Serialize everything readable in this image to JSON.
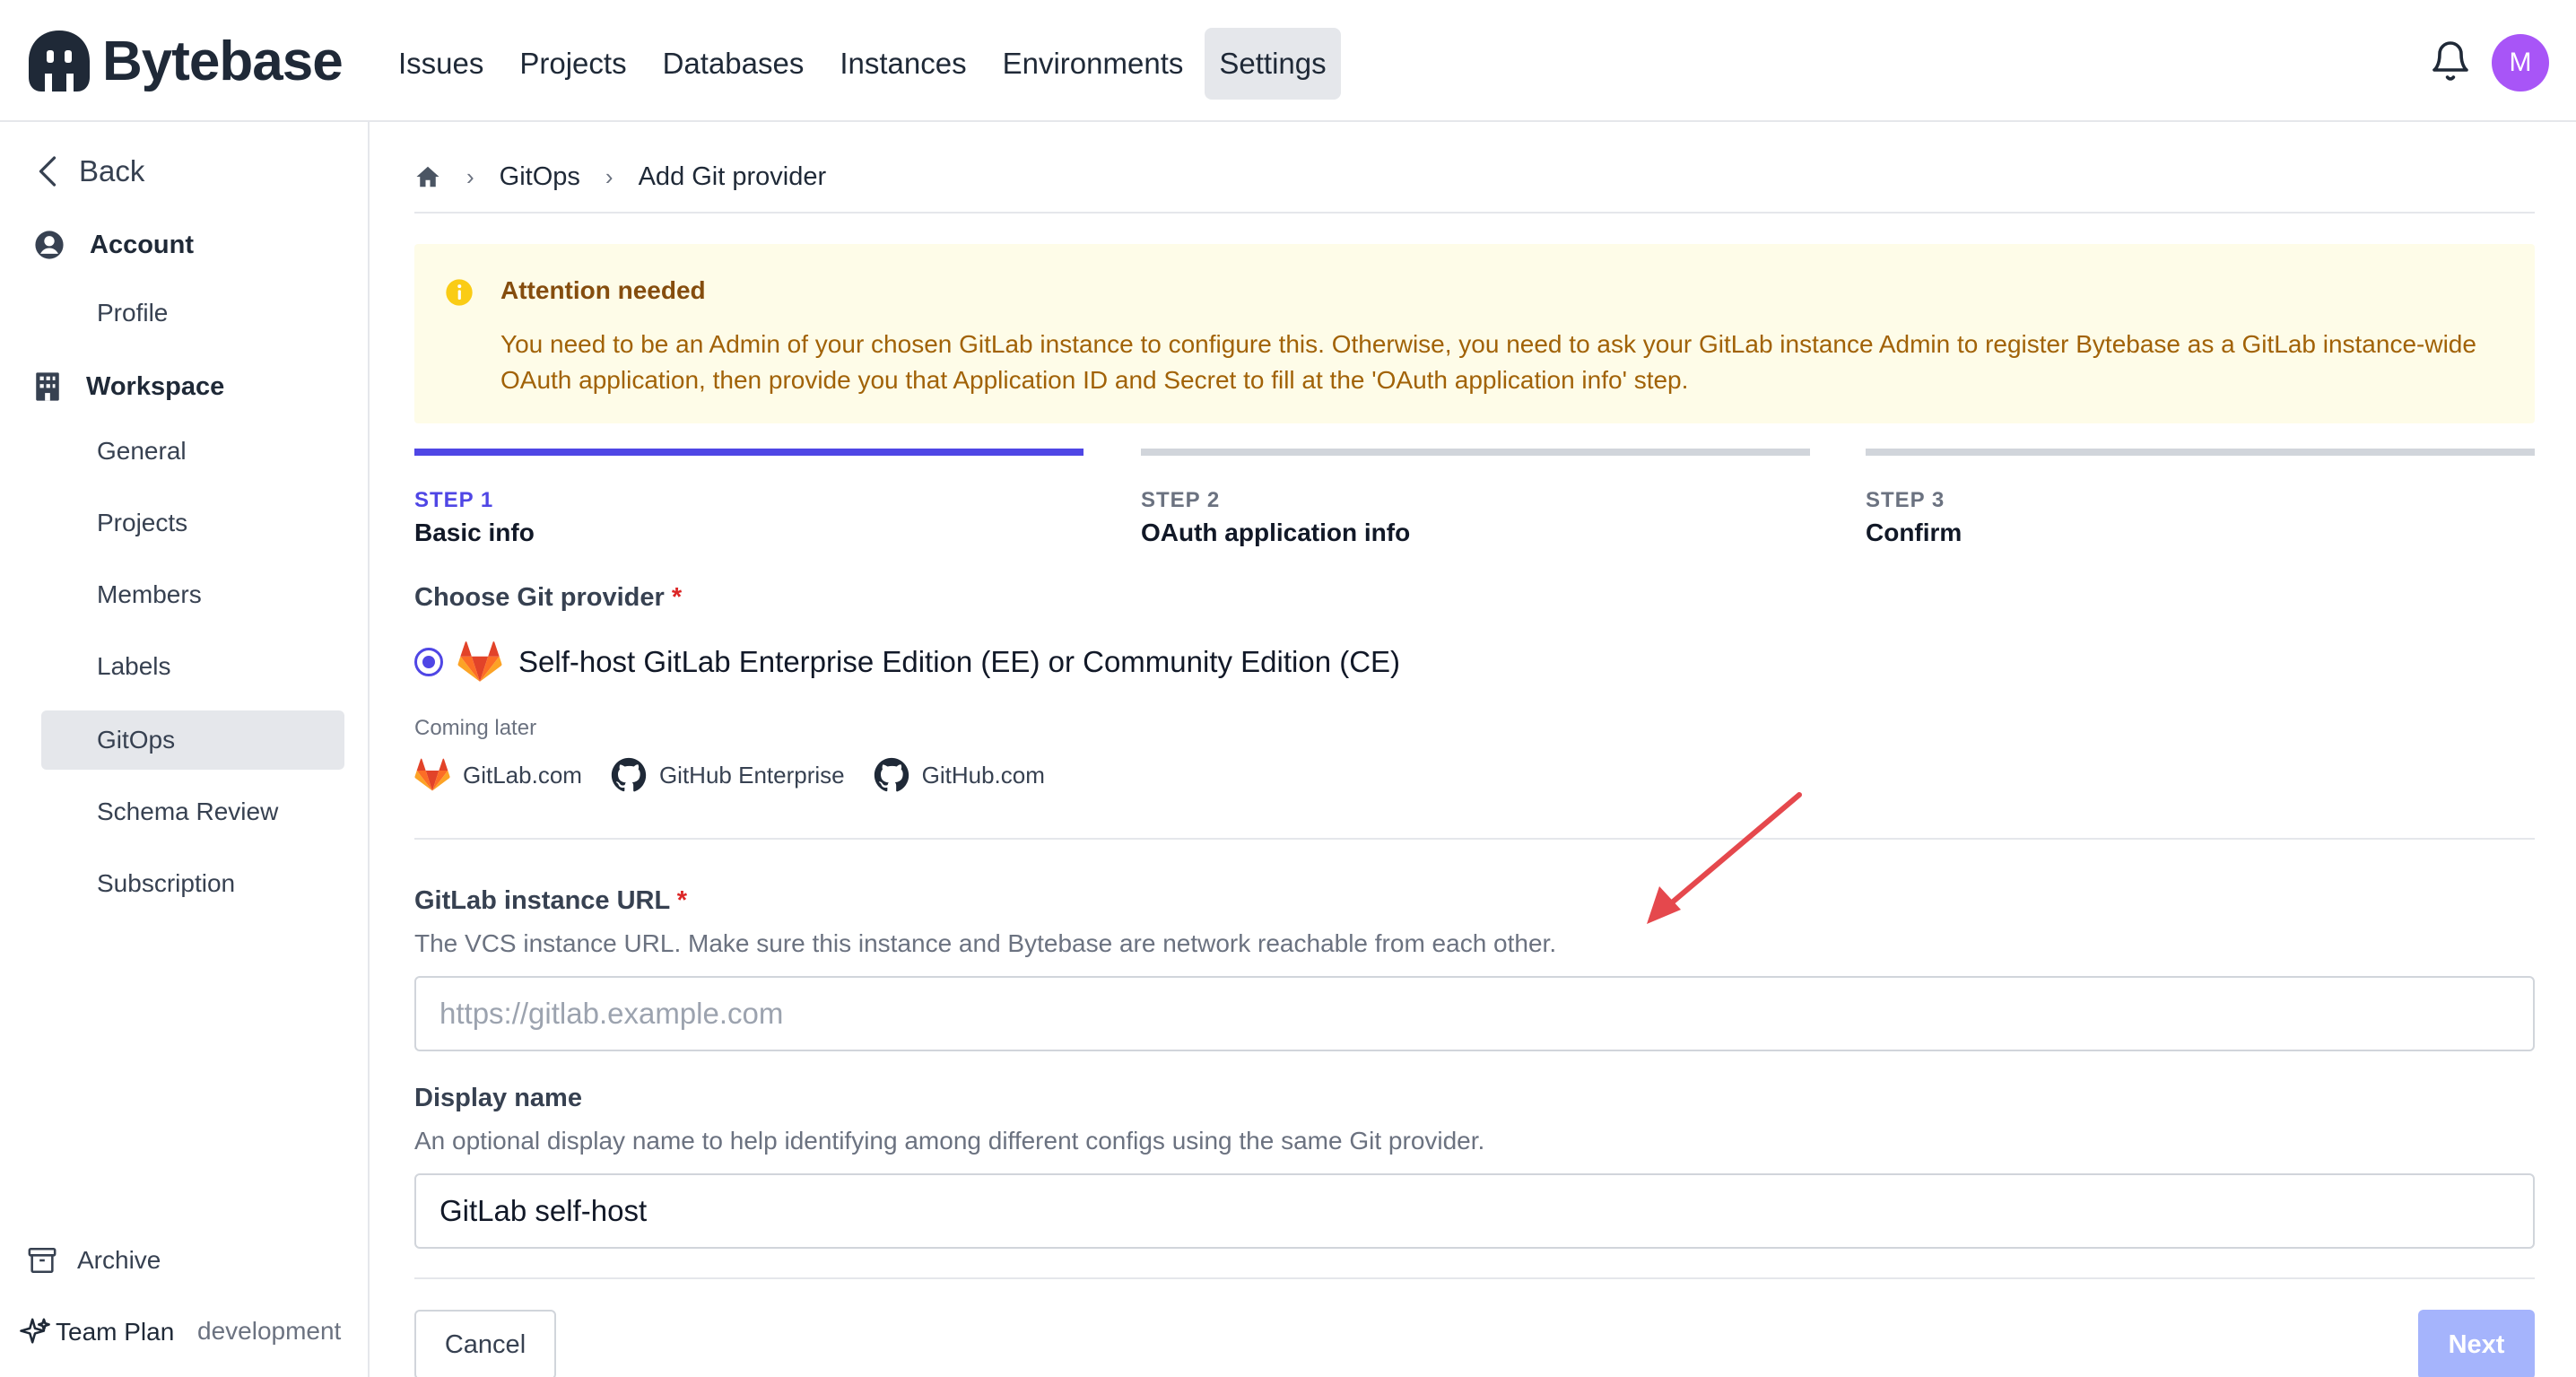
{
  "brand": {
    "name": "Bytebase"
  },
  "nav": {
    "items": [
      "Issues",
      "Projects",
      "Databases",
      "Instances",
      "Environments",
      "Settings"
    ],
    "active": "Settings"
  },
  "user": {
    "initial": "M",
    "avatar_color": "#a855f7"
  },
  "sidebar": {
    "back_label": "Back",
    "account_heading": "Account",
    "account_items": [
      "Profile"
    ],
    "workspace_heading": "Workspace",
    "workspace_items": [
      "General",
      "Projects",
      "Members",
      "Labels",
      "GitOps",
      "Schema Review",
      "Subscription"
    ],
    "active_item": "GitOps",
    "archive_label": "Archive",
    "plan_label": "Team Plan",
    "environment_label": "development"
  },
  "breadcrumb": {
    "section": "GitOps",
    "current": "Add Git provider"
  },
  "alert": {
    "title": "Attention needed",
    "body": "You need to be an Admin of your chosen GitLab instance to configure this. Otherwise, you need to ask your GitLab instance Admin to register Bytebase as a GitLab instance-wide OAuth application, then provide you that Application ID and Secret to fill at the 'OAuth application info' step."
  },
  "steps": [
    {
      "number": "STEP 1",
      "name": "Basic info",
      "active": true
    },
    {
      "number": "STEP 2",
      "name": "OAuth application info",
      "active": false
    },
    {
      "number": "STEP 3",
      "name": "Confirm",
      "active": false
    }
  ],
  "form": {
    "provider_label": "Choose Git provider",
    "required_mark": "*",
    "selected_provider": "Self-host GitLab Enterprise Edition (EE) or Community Edition (CE)",
    "coming_later_label": "Coming later",
    "coming_later": [
      "GitLab.com",
      "GitHub Enterprise",
      "GitHub.com"
    ],
    "url_label": "GitLab instance URL",
    "url_help": "The VCS instance URL. Make sure this instance and Bytebase are network reachable from each other.",
    "url_placeholder": "https://gitlab.example.com",
    "url_value": "",
    "name_label": "Display name",
    "name_help": "An optional display name to help identifying among different configs using the same Git provider.",
    "name_value": "GitLab self-host"
  },
  "actions": {
    "cancel": "Cancel",
    "next": "Next"
  },
  "colors": {
    "accent": "#4f46e5",
    "alert_bg": "#fefce8",
    "alert_text": "#a16207",
    "annotation_arrow": "#e5484d"
  }
}
